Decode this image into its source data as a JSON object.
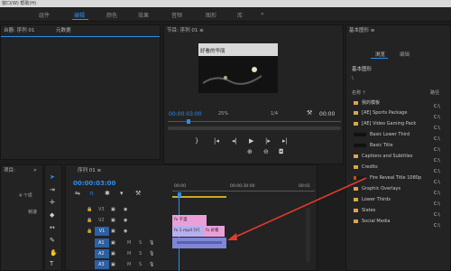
{
  "menubar": {
    "text": "窗口(W)  帮助(H)"
  },
  "workspaces": {
    "items": [
      "组件",
      "编辑",
      "颜色",
      "效果",
      "音频",
      "图形",
      "库"
    ],
    "more": "»",
    "active_index": 1
  },
  "source_panel": {
    "tab1": "台器: 序列 01",
    "tab2": "元数据",
    "menu": "≡"
  },
  "program_monitor": {
    "title": "节目: 序列 01 ≡",
    "overlay_text": "好看的华丽",
    "timecode_left": "00:00:03:00",
    "zoom": "25%",
    "resolution": "1/4",
    "timecode_right": "00:00"
  },
  "essential_graphics": {
    "title": "基本图形 ≡",
    "tab_browse": "浏览",
    "tab_edit": "编辑",
    "dropdown": "基本图形",
    "path": "\\",
    "col_name": "名称 ↑",
    "col_path": "路径",
    "items": [
      {
        "label": "我的模板",
        "kind": "folder"
      },
      {
        "label": "[AE] Sports Package",
        "kind": "folder"
      },
      {
        "label": "[AE] Video Gaming Pack",
        "kind": "folder"
      },
      {
        "label": "Basic Lower Third",
        "kind": "thumb"
      },
      {
        "label": "Basic Title",
        "kind": "thumb"
      },
      {
        "label": "Captions and Subtitles",
        "kind": "folder"
      },
      {
        "label": "Credits",
        "kind": "folder"
      },
      {
        "label": "Fire Reveal Title 1080p",
        "kind": "thumb"
      },
      {
        "label": "Graphic Overlays",
        "kind": "folder"
      },
      {
        "label": "Lower Thirds",
        "kind": "folder"
      },
      {
        "label": "Slates",
        "kind": "folder"
      },
      {
        "label": "Social Media",
        "kind": "folder"
      }
    ],
    "path_marker": "C:\\"
  },
  "project_panel": {
    "tab": "项目:",
    "count": "4 个项",
    "col": "帧速",
    "more": "»"
  },
  "timeline": {
    "title": "序列 01 ≡",
    "timecode": "00:00:03:00",
    "ruler_start": "00:00",
    "ruler_mid": "00:00:30:00",
    "ruler_end": "00:01",
    "tracks": [
      {
        "name": "V3"
      },
      {
        "name": "V2"
      },
      {
        "name": "V1"
      },
      {
        "name": "A1"
      },
      {
        "name": "A2"
      },
      {
        "name": "A3"
      }
    ],
    "clips": [
      {
        "label": "fx 千里",
        "color": "#e9a0d9"
      },
      {
        "label": "fx 1.mp4 [V]",
        "color": "#b7b0f0"
      },
      {
        "label": "fx 好看",
        "color": "#e9a0d9"
      },
      {
        "label": "",
        "color": "#7f86d6"
      }
    ]
  },
  "colors": {
    "accent": "#2d8ceb",
    "annotation_arrow": "#e23b2b"
  }
}
